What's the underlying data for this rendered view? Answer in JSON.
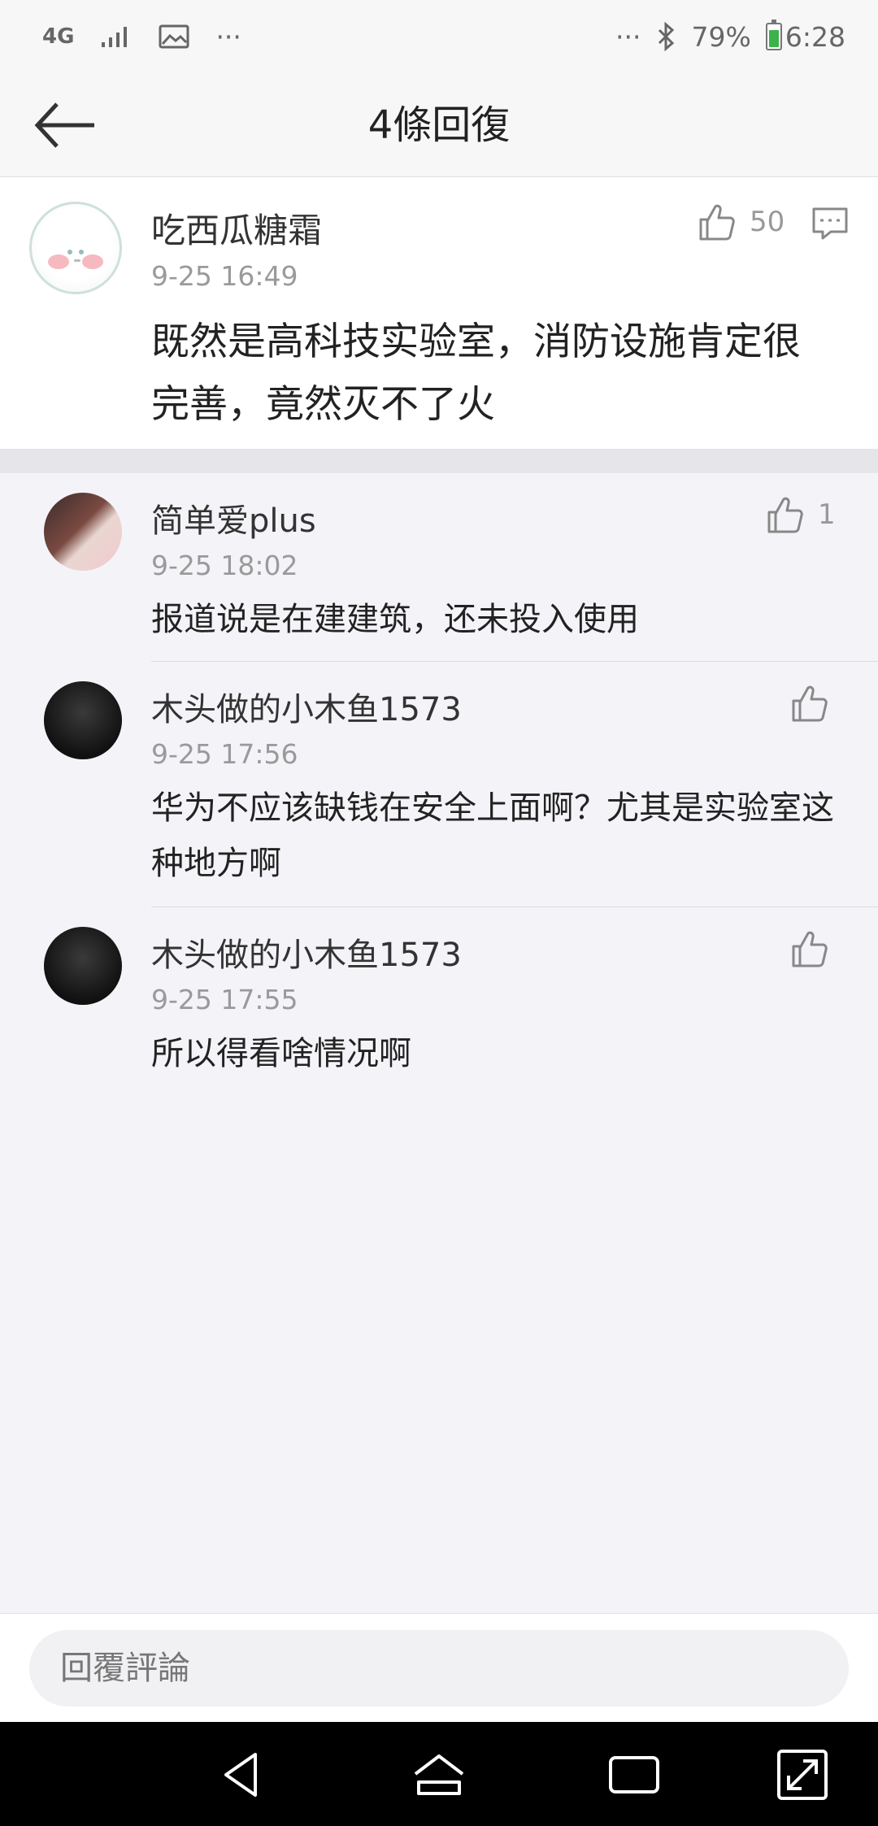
{
  "status_bar": {
    "network": "4G",
    "battery_percent": "79%",
    "time": "6:28",
    "more_left": "···",
    "more_right": "···"
  },
  "nav": {
    "title": "4條回復"
  },
  "main_comment": {
    "username": "吃西瓜糖霜",
    "timestamp": "9-25 16:49",
    "likes": "50",
    "text": "既然是高科技实验室，消防设施肯定很完善，竟然灭不了火"
  },
  "replies": [
    {
      "username": "简单爱plus",
      "timestamp": "9-25 18:02",
      "likes": "1",
      "text": "报道说是在建建筑，还未投入使用"
    },
    {
      "username": "木头做的小木鱼1573",
      "timestamp": "9-25 17:56",
      "likes": "",
      "text": "华为不应该缺钱在安全上面啊？尤其是实验室这种地方啊"
    },
    {
      "username": "木头做的小木鱼1573",
      "timestamp": "9-25 17:55",
      "likes": "",
      "text": "所以得看啥情况啊"
    }
  ],
  "reply_box": {
    "placeholder": "回覆評論"
  },
  "colors": {
    "background": "#f4f4f8",
    "card": "#ffffff",
    "secondary_text": "#9a9a9a",
    "nav_bar": "#000000"
  }
}
